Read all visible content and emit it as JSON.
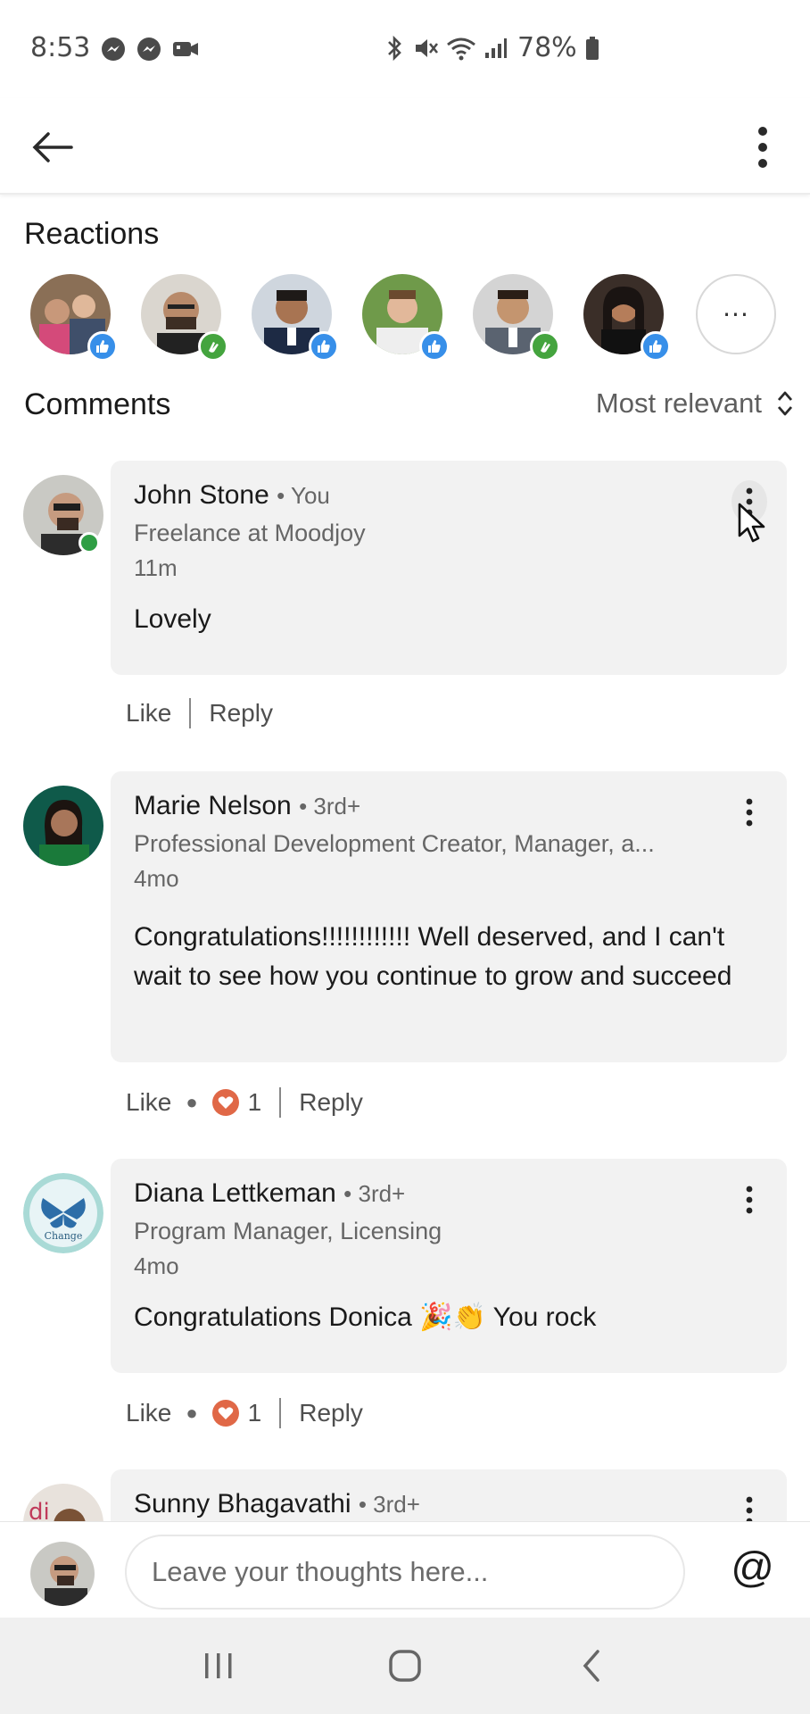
{
  "status_bar": {
    "time": "8:53",
    "battery": "78%",
    "left_icons": [
      "messenger-icon",
      "messenger-icon",
      "video-icon"
    ],
    "right_icons": [
      "bluetooth-icon",
      "mute-icon",
      "wifi-icon",
      "signal-icon",
      "battery-icon"
    ]
  },
  "app_bar": {
    "back_icon": "arrow-left-icon",
    "menu_icon": "more-vertical-icon"
  },
  "reactions": {
    "title": "Reactions",
    "reactors": [
      {
        "reaction": "like"
      },
      {
        "reaction": "celebrate"
      },
      {
        "reaction": "like"
      },
      {
        "reaction": "like"
      },
      {
        "reaction": "celebrate"
      },
      {
        "reaction": "like"
      }
    ],
    "more_label": "···"
  },
  "comments": {
    "title": "Comments",
    "sort_label": "Most relevant",
    "items": [
      {
        "name": "John Stone",
        "degree": "• You",
        "headline": "Freelance at Moodjoy",
        "time": "11m",
        "text": "Lovely",
        "like_label": "Like",
        "reply_label": "Reply",
        "reaction_count": null
      },
      {
        "name": "Marie Nelson",
        "degree": "• 3rd+",
        "headline": "Professional Development Creator, Manager, a...",
        "time": "4mo",
        "text": "Congratulations!!!!!!!!!!!! Well deserved, and I can't wait to see how you continue to grow and succeed",
        "like_label": "Like",
        "reply_label": "Reply",
        "reaction_count": "1"
      },
      {
        "name": "Diana Lettkeman",
        "degree": "• 3rd+",
        "headline": "Program Manager, Licensing",
        "time": "4mo",
        "text": "Congratulations Donica 🎉👏 You rock",
        "like_label": "Like",
        "reply_label": "Reply",
        "reaction_count": "1"
      },
      {
        "name": "Sunny Bhagavathi",
        "degree": "• 3rd+"
      }
    ]
  },
  "composer": {
    "placeholder": "Leave your thoughts here...",
    "mention_label": "@"
  },
  "colors": {
    "like_badge": "#378fe9",
    "celebrate_badge": "#44a43e",
    "heart_badge": "#e06847",
    "online": "#2f9e44",
    "bubble_bg": "#f2f2f2"
  }
}
